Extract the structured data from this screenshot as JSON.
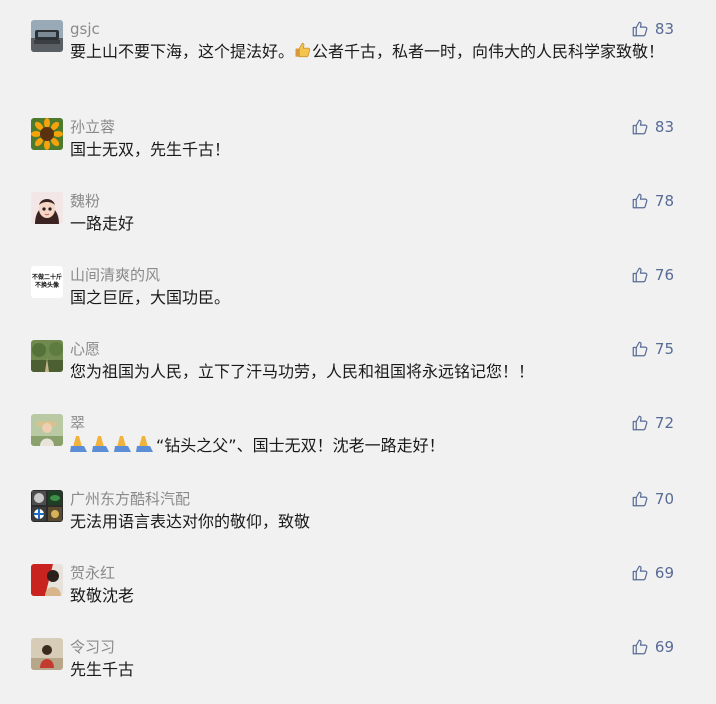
{
  "comments": [
    {
      "name": "gsjc",
      "text_a": "要上山不要下海，这个提法好。",
      "emoji": "thumbs-up",
      "text_b": "公者千古，私者一时，向伟大的人民科学家致敬！",
      "likes": "83"
    },
    {
      "name": "孙立蓉",
      "text": "国士无双，先生千古！",
      "likes": "83"
    },
    {
      "name": "魏粉",
      "text": "一路走好",
      "likes": "78"
    },
    {
      "name": "山间清爽的风",
      "avatar_text_1": "不做二十斤",
      "avatar_text_2": "不换头像",
      "text": "国之巨匠，大国功臣。",
      "likes": "76"
    },
    {
      "name": "心愿",
      "text": "您为祖国为人民，立下了汗马功劳，人民和祖国将永远铭记您！！",
      "likes": "75"
    },
    {
      "name": "翠",
      "emoji": "folded-hands x4",
      "text": "“钻头之父”、国士无双！沈老一路走好！",
      "likes": "72"
    },
    {
      "name": "广州东方酷科汽配",
      "text": "无法用语言表达对你的敬仰，致敬",
      "likes": "70"
    },
    {
      "name": "贺永红",
      "text": "致敬沈老",
      "likes": "69"
    },
    {
      "name": "令习习",
      "text": "先生千古",
      "likes": "69"
    }
  ],
  "colors": {
    "background": "#f1f1f1",
    "name": "#8a8a8a",
    "text": "#1a1a1a",
    "like": "#576b95"
  }
}
